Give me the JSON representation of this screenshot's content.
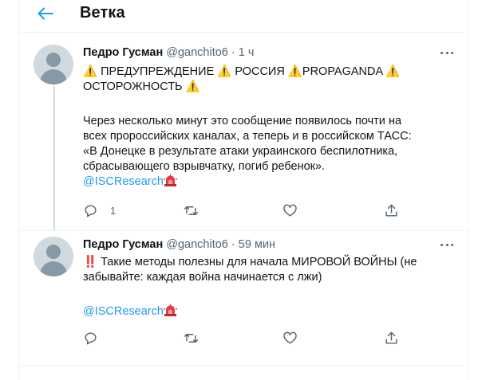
{
  "header": {
    "title": "Ветка"
  },
  "tweets": [
    {
      "name": "Педро Гусман",
      "handle": "@ganchito6",
      "dot": "·",
      "time": "1 ч",
      "line1": "⚠️ ПРЕДУПРЕЖДЕНИЕ ⚠️ РОССИЯ ⚠️PROPAGANDA ⚠️",
      "line2": "ОСТОРОЖНОСТЬ ⚠️",
      "para": [
        "Через несколько минут это сообщение появилось почти на",
        "всех пророссийских каналах, а теперь и в российском ТАСС:",
        "«В Донецке в результате атаки украинского беспилотника,",
        "сбрасывающего взрывчатку, погиб ребенок»."
      ],
      "mention": "@ISCResearch",
      "reply_count": "1"
    },
    {
      "name": "Педро Гусман",
      "handle": "@ganchito6",
      "dot": "·",
      "time": "59 мин",
      "line1": "‼️ Такие методы полезны для начала МИРОВОЙ ВОЙНЫ (не",
      "line2": "забывайте: каждая война начинается с лжи)",
      "mention": "@ISCResearch"
    }
  ],
  "icons": {
    "back": "arrow-left-icon",
    "more": "more-icon",
    "reply": "reply-icon",
    "retweet": "retweet-icon",
    "like": "heart-icon",
    "share": "share-icon",
    "siren": "siren-emoji"
  },
  "colors": {
    "accent": "#1d9bf0",
    "muted": "#536471",
    "text": "#0f1419",
    "divider": "#eff3f4"
  }
}
